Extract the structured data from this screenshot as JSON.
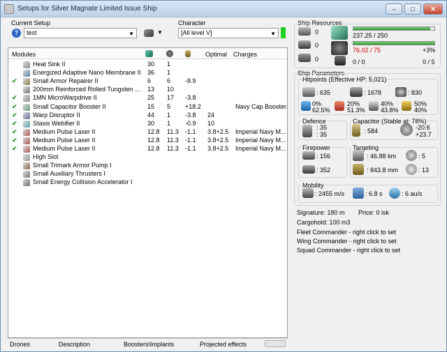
{
  "window": {
    "title": "Setups for Silver Magnate Limited Issue Ship",
    "min": "–",
    "max": "□",
    "close": "✕"
  },
  "setup": {
    "label": "Current Setup",
    "value": "test"
  },
  "character": {
    "label": "Character",
    "value": "[All level V]"
  },
  "modules": {
    "headers": {
      "name": "Modules",
      "optimal": "Optimal",
      "charges": "Charges"
    },
    "rows": [
      {
        "check": "",
        "name": "Heat Sink II",
        "c1": "30",
        "c2": "1",
        "c3": "",
        "opt": "",
        "charge": ""
      },
      {
        "check": "",
        "name": "Energized Adaptive Nano Membrane II",
        "c1": "36",
        "c2": "1",
        "c3": "",
        "opt": "",
        "charge": ""
      },
      {
        "check": "✔",
        "name": "Small Armor Repairer II",
        "c1": "6",
        "c2": "6",
        "c3": "-8.9",
        "opt": "",
        "charge": ""
      },
      {
        "check": "",
        "name": "200mm Reinforced Rolled Tungsten ...",
        "c1": "13",
        "c2": "10",
        "c3": "",
        "opt": "",
        "charge": ""
      },
      {
        "check": "✔",
        "name": "1MN MicroWarpdrive II",
        "c1": "25",
        "c2": "17",
        "c3": "-3.8",
        "opt": "",
        "charge": ""
      },
      {
        "check": "✔",
        "name": "Small Capacitor Booster II",
        "c1": "15",
        "c2": "5",
        "c3": "+18.2",
        "opt": "",
        "charge": "Navy Cap Booster..."
      },
      {
        "check": "✔",
        "name": "Warp Disruptor II",
        "c1": "44",
        "c2": "1",
        "c3": "-3.8",
        "opt": "24",
        "charge": ""
      },
      {
        "check": "✔",
        "name": "Stasis Webifier II",
        "c1": "30",
        "c2": "1",
        "c3": "-0.9",
        "opt": "10",
        "charge": ""
      },
      {
        "check": "✔",
        "name": "Medium Pulse Laser II",
        "c1": "12.8",
        "c2": "11.3",
        "c3": "-1.1",
        "opt": "3.8+2.5",
        "charge": "Imperial Navy M..."
      },
      {
        "check": "✔",
        "name": "Medium Pulse Laser II",
        "c1": "12.8",
        "c2": "11.3",
        "c3": "-1.1",
        "opt": "3.8+2.5",
        "charge": "Imperial Navy M..."
      },
      {
        "check": "✔",
        "name": "Medium Pulse Laser II",
        "c1": "12.8",
        "c2": "11.3",
        "c3": "-1.1",
        "opt": "3.8+2.5",
        "charge": "Imperial Navy M..."
      },
      {
        "check": "",
        "name": "High Slot",
        "c1": "",
        "c2": "",
        "c3": "",
        "opt": "",
        "charge": ""
      },
      {
        "check": "",
        "name": "Small Trimark Armor Pump I",
        "c1": "",
        "c2": "",
        "c3": "",
        "opt": "",
        "charge": ""
      },
      {
        "check": "",
        "name": "Small Auxiliary Thrusters I",
        "c1": "",
        "c2": "",
        "c3": "",
        "opt": "",
        "charge": ""
      },
      {
        "check": "",
        "name": "Small Energy Collision Accelerator I",
        "c1": "",
        "c2": "",
        "c3": "",
        "opt": "",
        "charge": ""
      }
    ]
  },
  "tabs": {
    "drones": "Drones",
    "description": "Description",
    "boosters": "Boosters\\Implants",
    "projected": "Projected effects"
  },
  "resources": {
    "label": "Ship Resources",
    "counts": [
      "0",
      "0",
      "0"
    ],
    "cpu": "237.25 / 250",
    "cpu_fill": 0.949,
    "power": "76.02 / 75",
    "power_fill": 1.0,
    "power_extra": "+3%",
    "drone_bw": "0 / 0",
    "drone_count": "0 / 5"
  },
  "params": {
    "label": "Ship Parameters",
    "hitpoints_label": "Hitpoints (Effective HP: 5,021)",
    "shield_hp": ": 635",
    "armor_hp": ": 1678",
    "structure_hp": ": 830",
    "resists": [
      {
        "top": "0%",
        "bottom": "62.5%"
      },
      {
        "top": "20%",
        "bottom": "51.3%"
      },
      {
        "top": "40%",
        "bottom": "43.8%"
      },
      {
        "top": "50%",
        "bottom": "40%"
      }
    ],
    "defence_label": "Defence",
    "defence_top": ": 35",
    "defence_bottom": ": 35",
    "capacitor_label": "Capacitor (Stable at: 78%)",
    "capacitor_value": ": 584",
    "cap_top": "-20.6",
    "cap_bottom": "+23.7",
    "firepower_label": "Firepower",
    "fire_top": ": 156",
    "fire_bottom": ": 352",
    "targeting_label": "Targeting",
    "range": ": 46.88 km",
    "targets": ": 5",
    "scanres": ": 843.8 mm",
    "sensor": ": 13",
    "mobility_label": "Mobility",
    "speed": ": 2455 m/s",
    "align": ": 6.8 s",
    "warp": ": 6 au/s"
  },
  "info": {
    "signature": "Signature: 180 m",
    "price": "Price: 0 isk",
    "cargohold": "Cargohold: 100 m3",
    "fleet": "Fleet Commander - right click to set",
    "wing": "Wing Commander - right click to set",
    "squad": "Squad Commander - right click to set"
  }
}
